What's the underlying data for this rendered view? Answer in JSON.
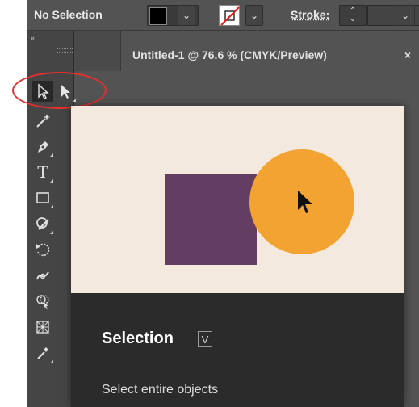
{
  "control_bar": {
    "selection_status": "No Selection",
    "fill_color": "#000000",
    "dropdown_arrow": "⌄",
    "stroke_label": "Stroke:",
    "stroke_stepper_up": "⌃",
    "stroke_stepper_down": "⌄"
  },
  "tools_panel": {
    "collapse_glyph": "‹‹",
    "tools": [
      {
        "name": "selection-tool",
        "icon": "arrow-pointer-icon",
        "selected": true
      },
      {
        "name": "direct-selection-tool",
        "icon": "filled-arrow-icon"
      },
      {
        "name": "magic-wand-tool",
        "icon": "magic-wand-icon"
      },
      {
        "name": "pen-tool",
        "icon": "pen-icon"
      },
      {
        "name": "type-tool",
        "icon": "type-icon",
        "glyph": "T"
      },
      {
        "name": "rectangle-tool",
        "icon": "rectangle-icon"
      },
      {
        "name": "shaper-tool",
        "icon": "shaper-icon"
      },
      {
        "name": "rotate-tool",
        "icon": "rotate-icon"
      },
      {
        "name": "width-tool",
        "icon": "width-icon"
      },
      {
        "name": "shape-builder-tool",
        "icon": "shape-builder-icon"
      },
      {
        "name": "perspective-grid-tool",
        "icon": "perspective-grid-icon"
      },
      {
        "name": "eyedropper-tool",
        "icon": "eyedropper-icon"
      }
    ]
  },
  "document": {
    "tab_title": "Untitled-1 @ 76.6 % (CMYK/Preview)",
    "close_glyph": "×"
  },
  "tooltip": {
    "title": "Selection",
    "shortcut": "V",
    "description": "Select entire objects",
    "colors": {
      "preview_background": "#f3e9df",
      "square": "#643e62",
      "circle": "#f2a331",
      "info_background": "#2b2b2b"
    }
  },
  "highlight": {
    "color": "#e53030"
  }
}
